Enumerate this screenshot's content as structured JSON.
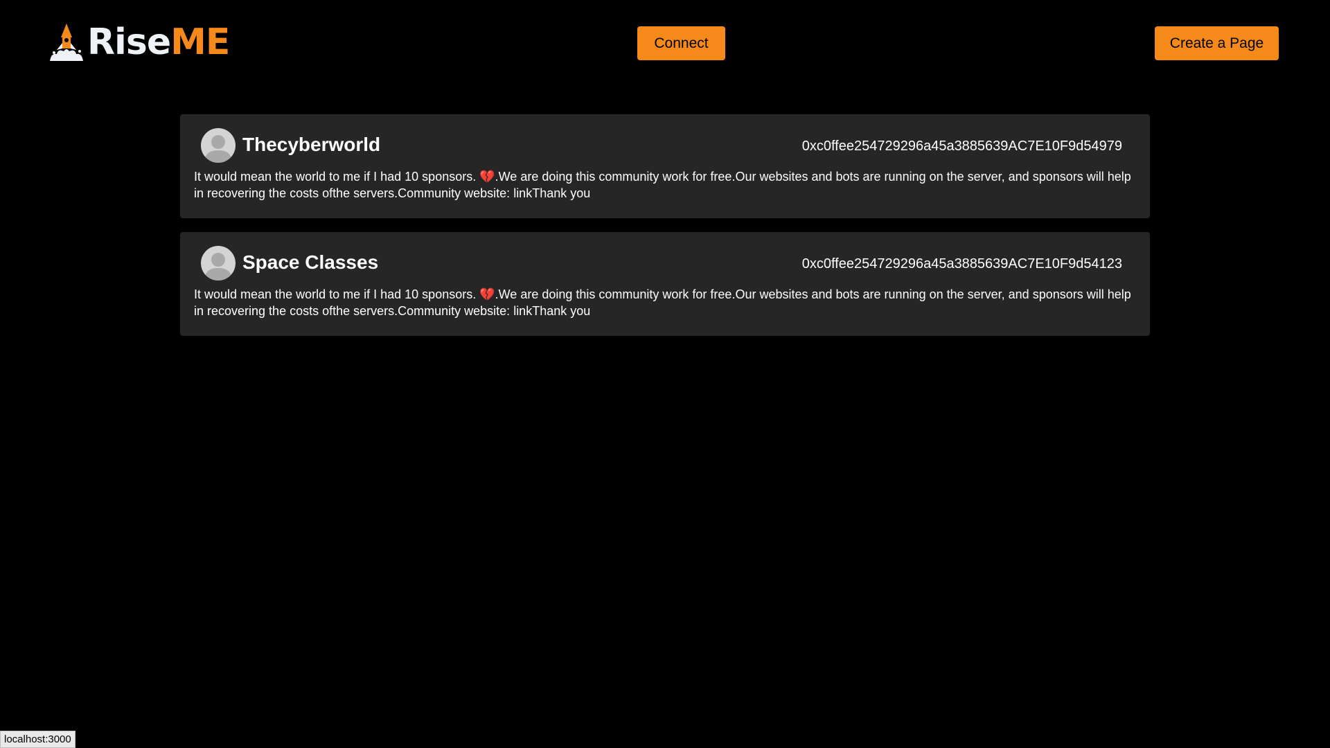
{
  "header": {
    "logo": {
      "part1": "Rise",
      "part2": "ME",
      "icon": "rocket-logo-icon"
    },
    "connect_label": "Connect",
    "create_label": "Create a Page"
  },
  "cards": [
    {
      "name": "Thecyberworld",
      "address": "0xc0ffee254729296a45a3885639AC7E10F9d54979",
      "description_before": "It would mean the world to me if I had 10 sponsors. ",
      "emoji": "💔",
      "description_after": ".We are doing this community work for free.Our websites and bots are running on the server, and sponsors will help in recovering the costs ofthe servers.Community website: linkThank you"
    },
    {
      "name": "Space Classes",
      "address": "0xc0ffee254729296a45a3885639AC7E10F9d54123",
      "description_before": "It would mean the world to me if I had 10 sponsors. ",
      "emoji": "💔",
      "description_after": ".We are doing this community work for free.Our websites and bots are running on the server, and sponsors will help in recovering the costs ofthe servers.Community website: linkThank you"
    }
  ],
  "status_bar": {
    "url": "localhost:3000"
  },
  "colors": {
    "accent": "#f5891a",
    "card_bg": "#262626",
    "page_bg": "#000000"
  }
}
